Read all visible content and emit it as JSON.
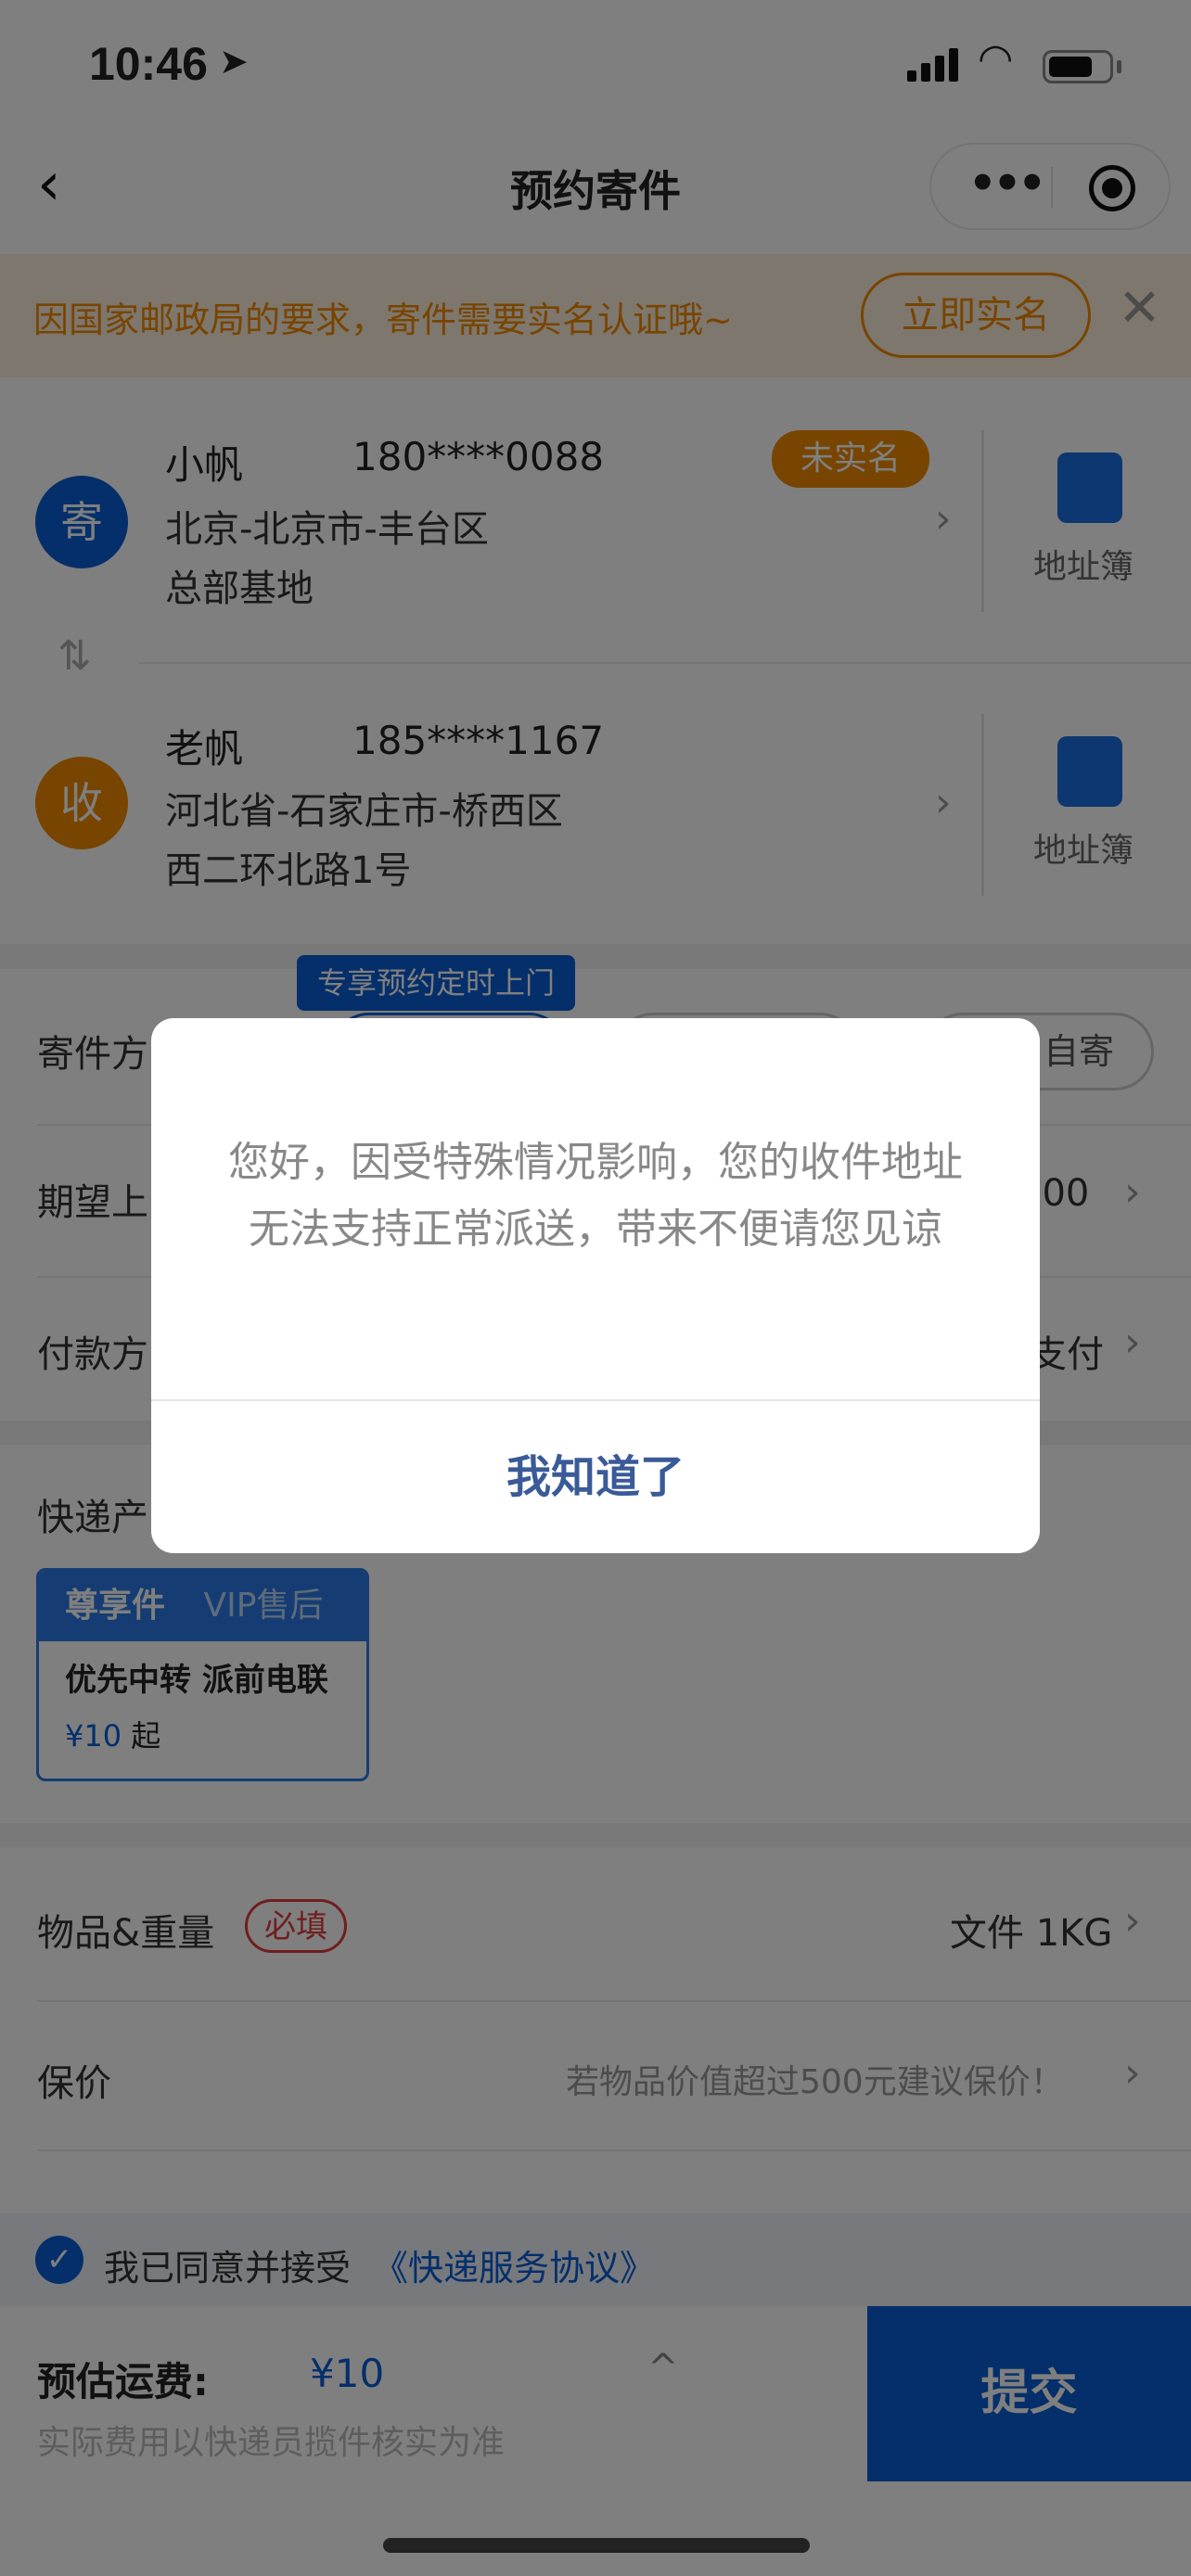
{
  "status_bar": {
    "time": "10:46"
  },
  "nav": {
    "title": "预约寄件",
    "back_icon": "chevron-left",
    "more_icon": "more-dots",
    "record_icon": "target-circle"
  },
  "banner": {
    "text": "因国家邮政局的要求，寄件需要实名认证哦~",
    "button": "立即实名"
  },
  "sender": {
    "badge": "寄",
    "name": "小帆",
    "phone": "180****0088",
    "status": "未实名",
    "region": "北京-北京市-丰台区",
    "street": "总部基地",
    "book": "地址簿"
  },
  "receiver": {
    "badge": "收",
    "name": "老帆",
    "phone": "185****1167",
    "region": "河北省-石家庄市-桥西区",
    "street": "西二环北路1号",
    "book": "地址簿"
  },
  "shipping": {
    "label": "寄件方",
    "tooltip": "专享预约定时上门",
    "option3": "自寄"
  },
  "pickup_time": {
    "label": "期望上",
    "value": ":00"
  },
  "payment": {
    "label": "付款方",
    "value": "支付"
  },
  "product": {
    "label": "快递产",
    "card_title": "尊享件",
    "card_badge": "VIP售后",
    "card_desc": "优先中转 派前电联",
    "card_price": "¥10",
    "card_price_suffix": "起"
  },
  "item": {
    "label": "物品&重量",
    "required": "必填",
    "value": "文件 1KG"
  },
  "insurance": {
    "label": "保价",
    "value": "若物品价值超过500元建议保价！"
  },
  "agreement": {
    "text": "我已同意并接受",
    "link": "《快递服务协议》",
    "checked": true
  },
  "footer": {
    "fee_label": "预估运费:",
    "fee": "¥10",
    "note": "实际费用以快递员揽件核实为准",
    "submit": "提交"
  },
  "modal": {
    "message": "您好，因受特殊情况影响，您的收件地址无法支持正常派送，带来不便请您见谅",
    "button": "我知道了"
  },
  "colors": {
    "brand": "#0a5fd6",
    "orange": "#f08a00",
    "dialog_button": "#3a5a98"
  }
}
